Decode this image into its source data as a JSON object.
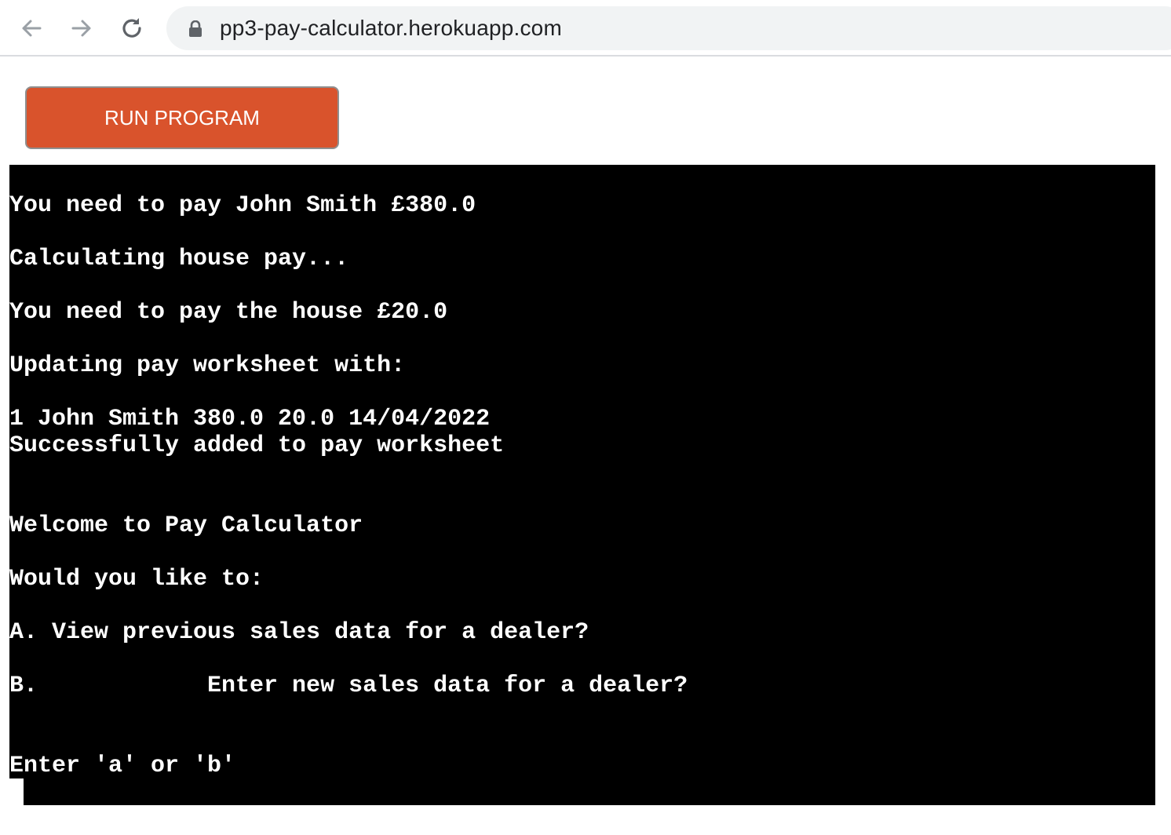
{
  "browser": {
    "url": "pp3-pay-calculator.herokuapp.com"
  },
  "toolbar": {
    "run_label": "RUN PROGRAM",
    "run_color": "#d9532c"
  },
  "terminal": {
    "background": "#000000",
    "lines": [
      "You need to pay John Smith £380.0",
      "Calculating house pay...",
      "You need to pay the house £20.0",
      "Updating pay worksheet with:",
      "1 John Smith 380.0 20.0 14/04/2022",
      "Successfully added to pay worksheet",
      "Welcome to Pay Calculator",
      "Would you like to:",
      "A. View previous sales data for a dealer?",
      "B.            Enter new sales data for a dealer?",
      "Enter 'a' or 'b'"
    ]
  }
}
